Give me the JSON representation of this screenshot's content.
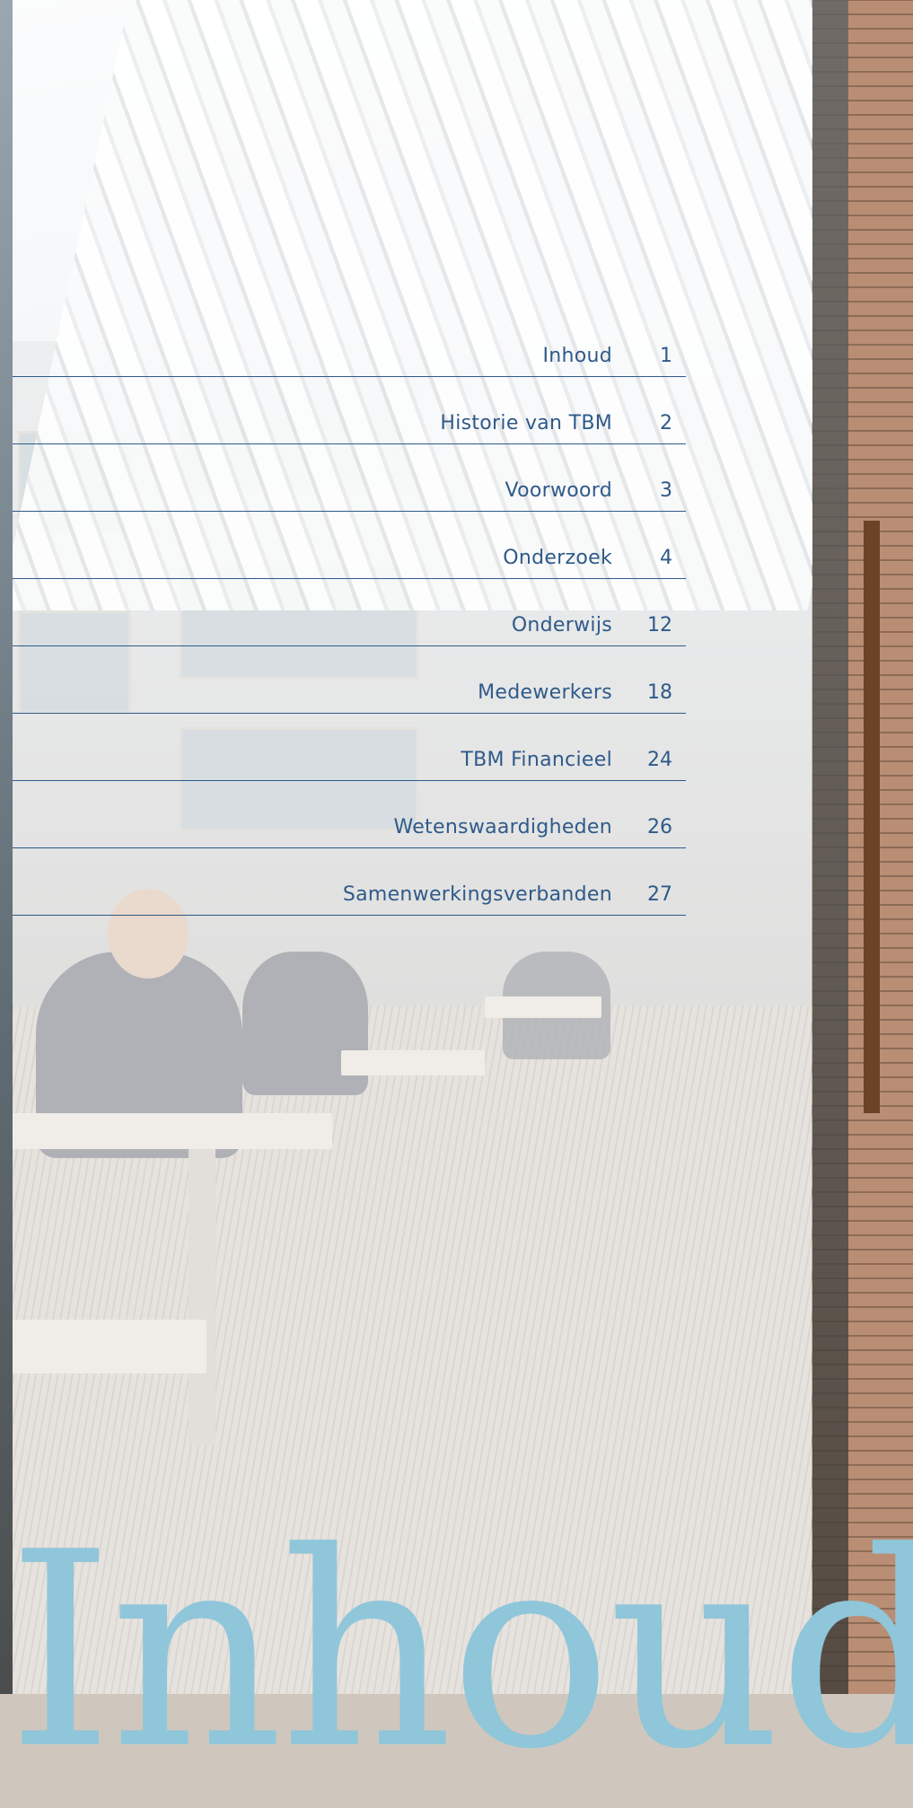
{
  "toc": [
    {
      "title": "Inhoud",
      "page": "1"
    },
    {
      "title": "Historie van TBM",
      "page": "2"
    },
    {
      "title": "Voorwoord",
      "page": "3"
    },
    {
      "title": "Onderzoek",
      "page": "4"
    },
    {
      "title": "Onderwijs",
      "page": "12"
    },
    {
      "title": "Medewerkers",
      "page": "18"
    },
    {
      "title": "TBM Financieel",
      "page": "24"
    },
    {
      "title": "Wetenswaardigheden",
      "page": "26"
    },
    {
      "title": "Samenwerkingsverbanden",
      "page": "27"
    }
  ],
  "heading": "Inhoud",
  "colors": {
    "accent": "#2f5a8a",
    "heading": "#8fc6da"
  }
}
